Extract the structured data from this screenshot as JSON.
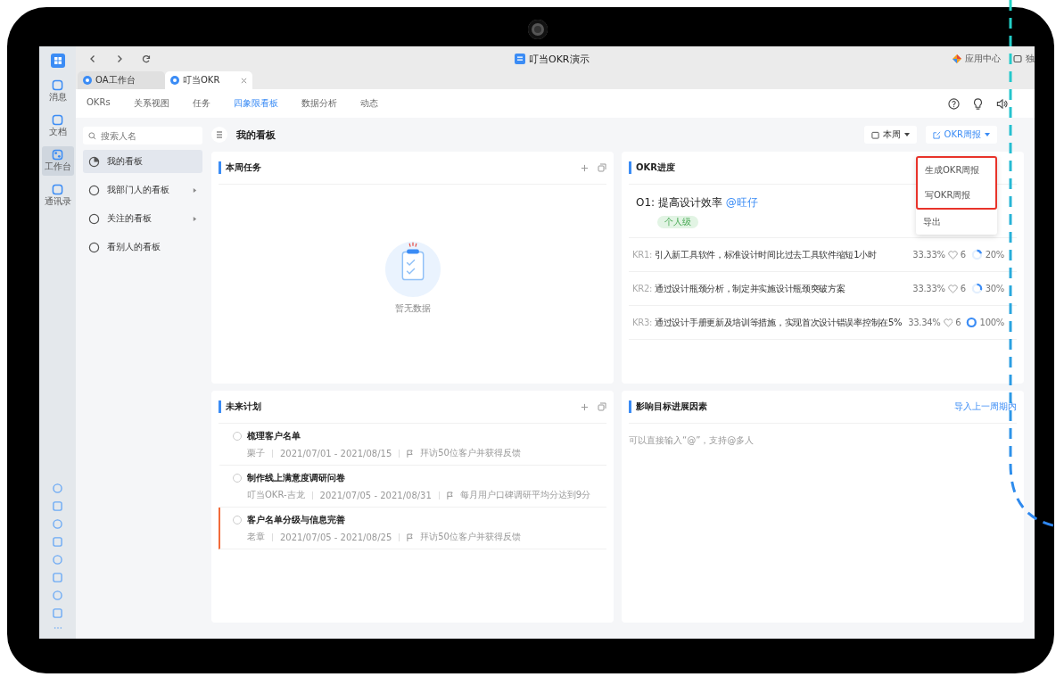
{
  "window": {
    "title": "叮当OKR演示",
    "shortcuts": [
      "应用中心",
      "独"
    ]
  },
  "browser_tabs": [
    {
      "label": "OA工作台",
      "selected": false
    },
    {
      "label": "叮当OKR",
      "selected": true
    }
  ],
  "rail": {
    "items": [
      {
        "label": "消息",
        "selected": false
      },
      {
        "label": "文档",
        "selected": false
      },
      {
        "label": "工作台",
        "selected": true
      },
      {
        "label": "通讯录",
        "selected": false
      }
    ]
  },
  "nav_tabs": [
    {
      "label": "OKRs",
      "selected": false
    },
    {
      "label": "关系视图",
      "selected": false
    },
    {
      "label": "任务",
      "selected": false
    },
    {
      "label": "四象限看板",
      "selected": true
    },
    {
      "label": "数据分析",
      "selected": false
    },
    {
      "label": "动态",
      "selected": false
    }
  ],
  "side_panel": {
    "search": {
      "placeholder": "搜索人名"
    },
    "items": [
      {
        "label": "我的看板",
        "selected": true,
        "expandable": false
      },
      {
        "label": "我部门人的看板",
        "selected": false,
        "expandable": true
      },
      {
        "label": "关注的看板",
        "selected": false,
        "expandable": true
      },
      {
        "label": "看别人的看板",
        "selected": false,
        "expandable": false
      }
    ]
  },
  "board": {
    "title": "我的看板",
    "period_button": "本周",
    "report_button": "OKR周报"
  },
  "report_menu": {
    "items": [
      {
        "label": "生成OKR周报",
        "highlighted": true
      },
      {
        "label": "写OKR周报",
        "highlighted": true
      },
      {
        "label": "导出",
        "highlighted": false
      }
    ]
  },
  "weekly_tasks": {
    "title": "本周任务",
    "empty_text": "暂无数据"
  },
  "okr_progress": {
    "title": "OKR进度",
    "objective": {
      "code": "O1:",
      "title": "提高设计效率",
      "mention": "@旺仔",
      "tag": "个人级"
    },
    "key_results": [
      {
        "code": "KR1:",
        "text": "引入新工具软件，标准设计时间比过去工具软件缩短1小时",
        "weight": "33.33%",
        "likes": "6",
        "level": 0.2,
        "reading": "20%"
      },
      {
        "code": "KR2:",
        "text": "通过设计瓶颈分析，制定并实施设计瓶颈突破方案",
        "weight": "33.33%",
        "likes": "6",
        "level": 0.3,
        "reading": "30%"
      },
      {
        "code": "KR3:",
        "text": "通过设计手册更新及培训等措施，实现首次设计错误率控制在5%",
        "weight": "33.34%",
        "likes": "6",
        "level": 1,
        "reading": "100%"
      }
    ]
  },
  "future_plans": {
    "title": "未来计划",
    "items": [
      {
        "title": "梳理客户名单",
        "owner": "栗子",
        "dates": "2021/07/01 - 2021/08/15",
        "key_result": "拜访50位客户并获得反馈",
        "done": false,
        "flagged": false
      },
      {
        "title": "制作线上满意度调研问卷",
        "owner": "叮当OKR-吉龙",
        "dates": "2021/07/05 - 2021/08/31",
        "key_result": "每月用户口碑调研平均分达到9分",
        "done": false,
        "flagged": false
      },
      {
        "title": "客户名单分级与信息完善",
        "owner": "老章",
        "dates": "2021/07/05 - 2021/08/25",
        "key_result": "拜访50位客户并获得反馈",
        "done": false,
        "flagged": true
      }
    ]
  },
  "factors": {
    "title": "影响目标进展因素",
    "import_link": "导入上一周期内",
    "placeholder": "可以直接输入“@”，支持@多人"
  }
}
